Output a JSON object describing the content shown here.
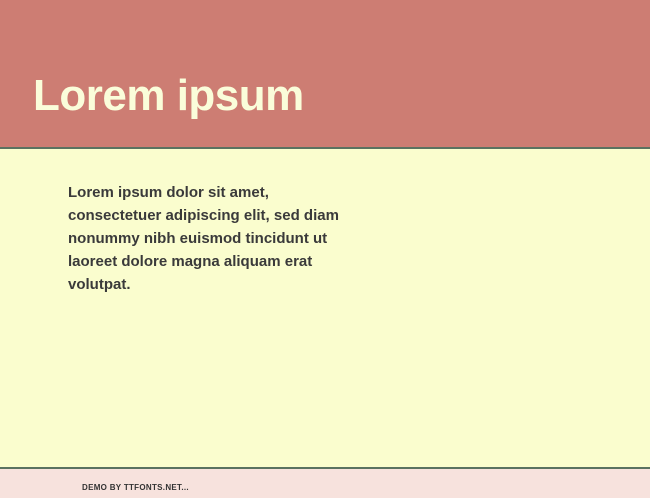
{
  "header": {
    "title": "Lorem ipsum"
  },
  "content": {
    "body_text": "Lorem ipsum dolor sit amet, consectetuer adipiscing elit, sed diam nonummy nibh euismod tincidunt ut laoreet dolore magna aliquam erat volutpat."
  },
  "footer": {
    "text": "DEMO BY TTFONTS.NET..."
  }
}
